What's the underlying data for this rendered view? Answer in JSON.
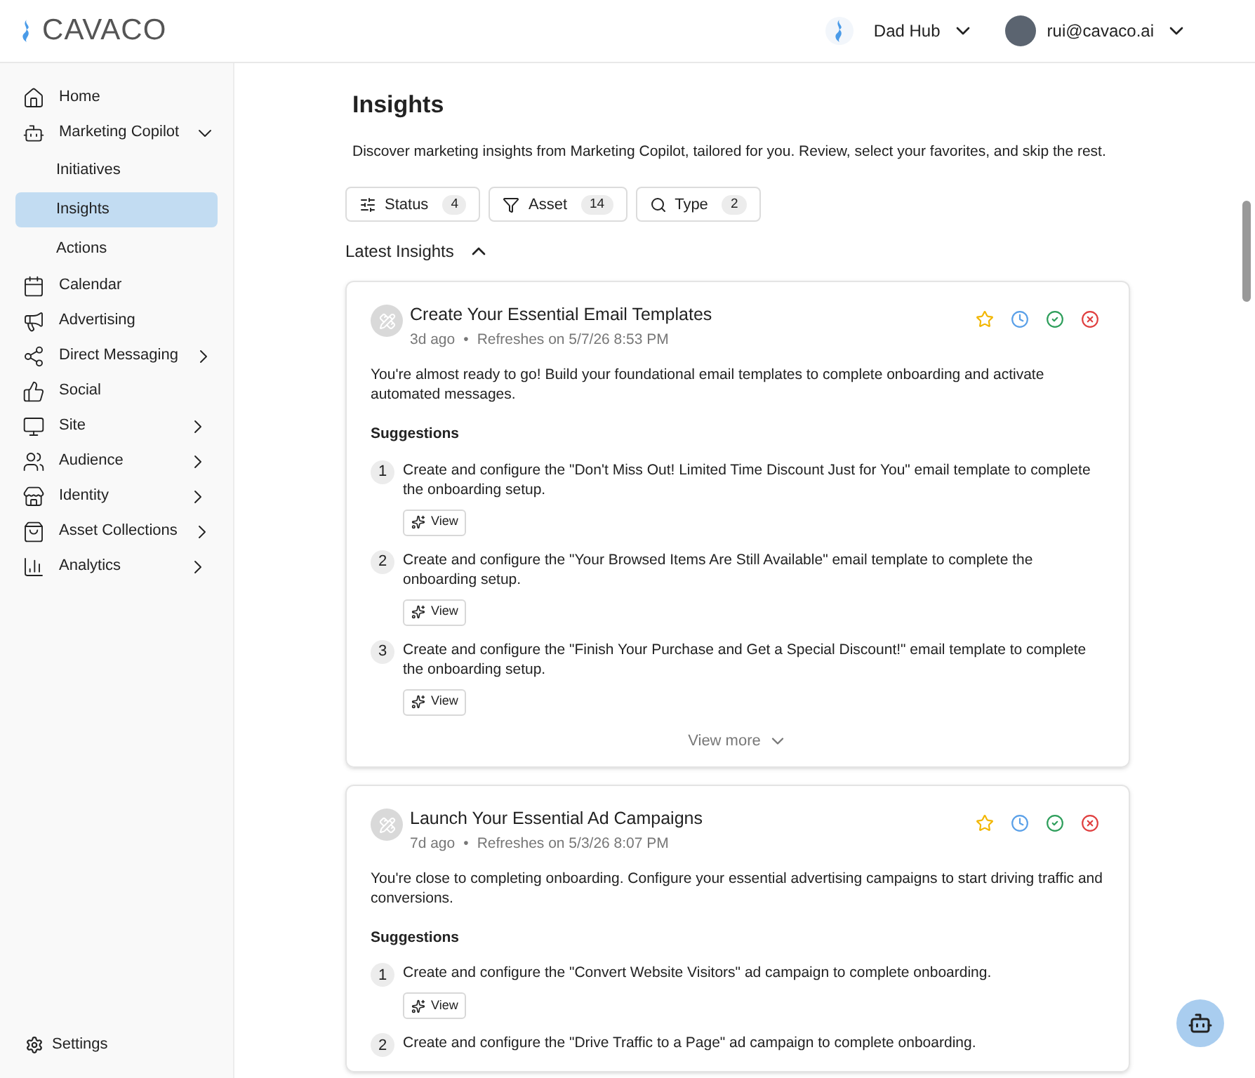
{
  "header": {
    "logo": "CAVACO",
    "workspace": "Dad Hub",
    "user": "rui@cavaco.ai"
  },
  "sidebar": {
    "items": [
      {
        "label": "Home",
        "kind": "link"
      },
      {
        "label": "Marketing Copilot",
        "kind": "group",
        "expanded": true,
        "children": [
          {
            "label": "Initiatives",
            "selected": false
          },
          {
            "label": "Insights",
            "selected": true
          },
          {
            "label": "Actions",
            "selected": false
          }
        ]
      },
      {
        "label": "Calendar",
        "kind": "link"
      },
      {
        "label": "Advertising",
        "kind": "link"
      },
      {
        "label": "Direct Messaging",
        "kind": "group",
        "expanded": false
      },
      {
        "label": "Social",
        "kind": "link"
      },
      {
        "label": "Site",
        "kind": "group",
        "expanded": false
      },
      {
        "label": "Audience",
        "kind": "group",
        "expanded": false
      },
      {
        "label": "Identity",
        "kind": "group",
        "expanded": false
      },
      {
        "label": "Asset Collections",
        "kind": "group",
        "expanded": false
      },
      {
        "label": "Analytics",
        "kind": "group",
        "expanded": false
      }
    ],
    "settings": "Settings"
  },
  "page": {
    "title": "Insights",
    "subtitle": "Discover marketing insights from Marketing Copilot, tailored for you. Review, select your favorites, and skip the rest.",
    "filters": [
      {
        "label": "Status",
        "count": "4"
      },
      {
        "label": "Asset",
        "count": "14"
      },
      {
        "label": "Type",
        "count": "2"
      }
    ],
    "section": {
      "title": "Latest Insights",
      "expanded": true
    },
    "cards": [
      {
        "title": "Create Your Essential Email Templates",
        "age": "3d ago",
        "bullet": "•",
        "refresh": "Refreshes on 5/7/26 8:53 PM",
        "description": "You're almost ready to go! Build your foundational email templates to complete onboarding and activate automated messages.",
        "suggestions_title": "Suggestions",
        "suggestions": [
          {
            "number": "1",
            "text": "Create and configure the \"Don't Miss Out! Limited Time Discount Just for You\" email template to complete the onboarding setup.",
            "view": "View"
          },
          {
            "number": "2",
            "text": "Create and configure the \"Your Browsed Items Are Still Available\" email template to complete the onboarding setup.",
            "view": "View"
          },
          {
            "number": "3",
            "text": "Create and configure the \"Finish Your Purchase and Get a Special Discount!\" email template to complete the onboarding setup.",
            "view": "View"
          }
        ],
        "view_more": "View more"
      },
      {
        "title": "Launch Your Essential Ad Campaigns",
        "age": "7d ago",
        "bullet": "•",
        "refresh": "Refreshes on 5/3/26 8:07 PM",
        "description": "You're close to completing onboarding. Configure your essential advertising campaigns to start driving traffic and conversions.",
        "suggestions_title": "Suggestions",
        "suggestions": [
          {
            "number": "1",
            "text": "Create and configure the \"Convert Website Visitors\" ad campaign to complete onboarding.",
            "view": "View"
          },
          {
            "number": "2",
            "text": "Create and configure the \"Drive Traffic to a Page\" ad campaign to complete onboarding."
          }
        ]
      }
    ]
  }
}
